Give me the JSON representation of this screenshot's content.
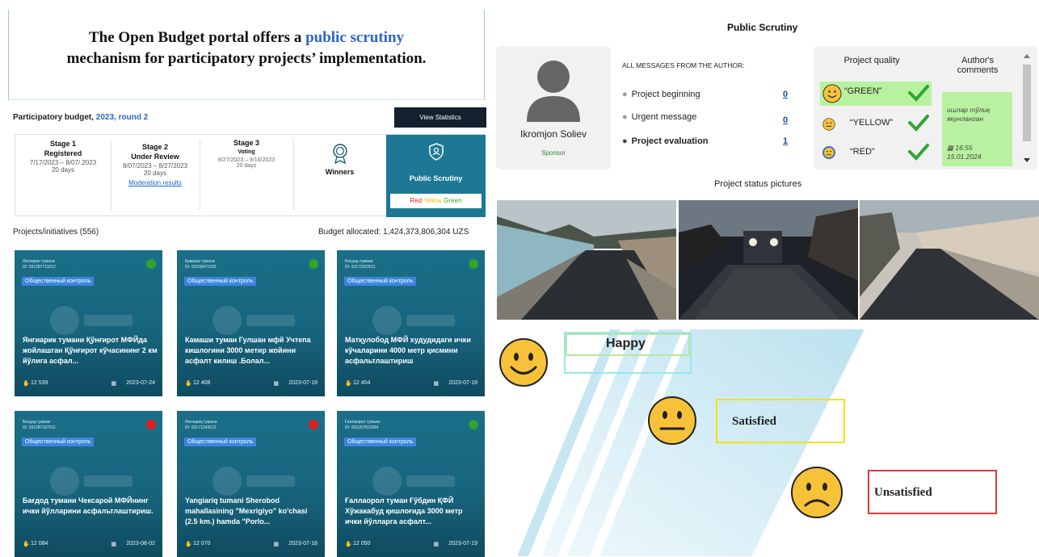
{
  "banner": {
    "line1_pre": "The Open Budget portal offers a ",
    "line1_hl": "public scrutiny",
    "line2": "mechanism for participatory projects’ implementation."
  },
  "pb": {
    "title_pre": "Participatory budget, ",
    "title_year": "2023, round 2",
    "view_stats": "View Statistics"
  },
  "stages": [
    {
      "num": "Stage 1",
      "name": "Registered",
      "dates": "7/17/2023 – 8/07/.2023",
      "days": "20 days"
    },
    {
      "num": "Stage 2",
      "name": "Under Review",
      "dates": "8/07/2023 – 8/27/2023",
      "days": "20 days",
      "link": "Moderation results"
    },
    {
      "num": "Stage 3",
      "name": "Voting",
      "dates": "8/27/2023 – 9/16/2023",
      "days": "20 days"
    }
  ],
  "winners": "Winners",
  "public_scrutiny_box": {
    "label": "Public Scrutiny",
    "red": "Red",
    "yellow": "Yellow",
    "green": "Green"
  },
  "projects_count": "Projects/initiatives (556)",
  "budget": "Budget allocated: 1,424,373,806,304 UZS",
  "cards": [
    {
      "district": "Янгиарик тумани",
      "id": "ID: 031287711012",
      "tag": "Общественный контроль",
      "status": "green",
      "title": "Янгиарик тумани Қўнғирот МФЙда жойлашган Қўнғирот кўчасининг 2 км йўлига асфал...",
      "likes": "12 539",
      "date": "2023-07-24"
    },
    {
      "district": "Қамаши тумани",
      "id": "ID: 03169471005",
      "tag": "Общественный контроль",
      "status": "green",
      "title": "Камаши туман Гулшан мфй Учтепа кишлогини 3000 метир жойини асфалт килиш .Болал...",
      "likes": "12 408",
      "date": "2023-07-18"
    },
    {
      "district": "Боғдод тумани",
      "id": "ID: 03172622011",
      "tag": "Общественный контроль",
      "status": "green",
      "title": "Матқулобод МФЙ худудидаги ички кўчаларини 4000 метр қисмини асфальтлаштириш",
      "likes": "12 404",
      "date": "2023-07-18"
    },
    {
      "district": "Боғдод тумани",
      "id": "ID: 031287197011",
      "tag": "Общественный контроль",
      "status": "red",
      "title": "Бағдод тумани Чексарой МФЙнинг ички йўлларини асфальтлаштириш.",
      "likes": "12 084",
      "date": "2023-08-02"
    },
    {
      "district": "Янгиариқ тумани",
      "id": "ID: 03171243012",
      "tag": "Общественный контроль",
      "status": "red",
      "title": "Yangiariq tumani Sherobod mahallasining \"Mexrigiyo\" ko'chasi (2.5 km.) hamda \"Porlo...",
      "likes": "12 070",
      "date": "2023-07-18"
    },
    {
      "district": "Ғаллаорол тумани",
      "id": "ID: 031257615004",
      "tag": "Общественный контроль",
      "status": "green",
      "title": "Ғаллаорол туман Ғўбдин ҚФЙ Хўжакабуд қишлоғида 3000 метр ички йўлларга асфалт...",
      "likes": "12 050",
      "date": "2023-07-19"
    }
  ],
  "scrutiny": {
    "title": "Public Scrutiny",
    "author_name": "Ikromjon Soliev",
    "author_role": "Sponsor",
    "messages_header": "ALL MESSAGES FROM THE AUTHOR:",
    "messages": [
      {
        "label": "Project beginning",
        "count": "0"
      },
      {
        "label": "Urgent message",
        "count": "0"
      },
      {
        "label": "Project evaluation",
        "count": "1"
      }
    ],
    "quality_header": "Project quality",
    "comments_header": "Author's comments",
    "quality": [
      {
        "label": "“GREEN”"
      },
      {
        "label": "“YELLOW”"
      },
      {
        "label": "“RED”"
      }
    ],
    "comment_text": "ишлар тўлиқ якунланган",
    "comment_time": "16:55",
    "comment_date": "15.01.2024",
    "pictures_title": "Project status pictures"
  },
  "legend": {
    "happy": "Happy",
    "satisfied": "Satisfied",
    "unsatisfied": "Unsatisfied"
  },
  "colors": {
    "accent": "#2a66c8",
    "teal": "#1c7894",
    "green_dot": "#2ea52e",
    "red_dot": "#e01d1d",
    "quality_green": "#b8f2a0"
  }
}
